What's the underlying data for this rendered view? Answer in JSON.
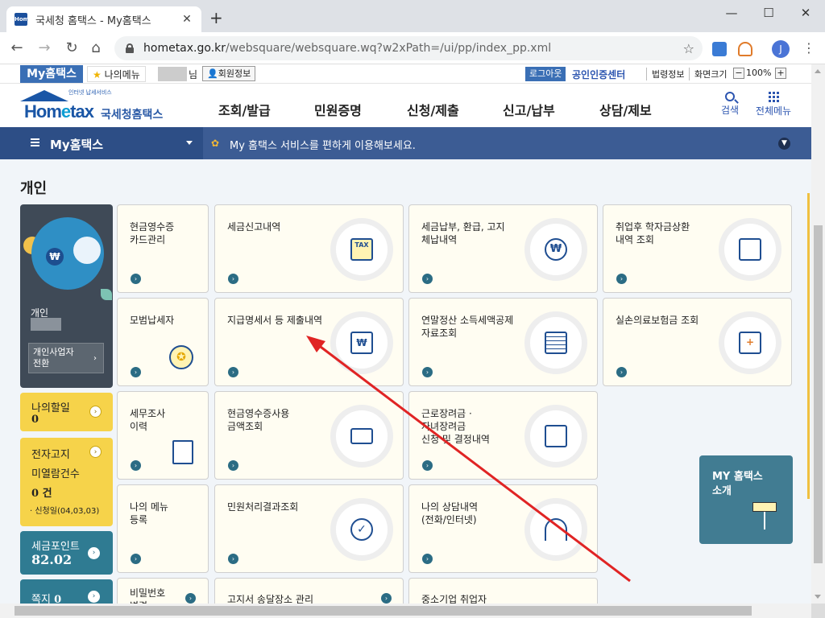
{
  "browser": {
    "tab_title": "국세청 홈택스 - My홈택스",
    "favicon_text": "Home",
    "url_domain": "hometax.go.kr",
    "url_path": "/websquare/websquare.wq?w2xPath=/ui/pp/index_pp.xml",
    "profile_initial": "J"
  },
  "util": {
    "my_hometax": "My홈택스",
    "my_menu": "나의메뉴",
    "name_suffix": "님",
    "member_info": "회원정보",
    "logout": "로그아웃",
    "cert_center": "공인인증센터",
    "law_info": "법령정보",
    "screen_size": "화면크기",
    "zoom_minus": "−",
    "zoom_value": "100%",
    "zoom_plus": "+"
  },
  "logo": {
    "tagline": "인터넷 납세서비스",
    "brand_pre": "Hom",
    "brand_e": "e",
    "brand_post": "tax",
    "brand_kor": "국세청홈택스"
  },
  "gnb": {
    "items": [
      "조회/발급",
      "민원증명",
      "신청/제출",
      "신고/납부",
      "상담/제보"
    ],
    "search": "검색",
    "all_menu": "전체메뉴"
  },
  "subbar": {
    "title": "My홈택스",
    "message": "My 홈택스 서비스를 편하게 이용해보세요."
  },
  "section_title": "개인",
  "profile": {
    "kind": "개인",
    "switch_label": "개인사업자\n전환",
    "won": "₩"
  },
  "side": {
    "todo_label": "나의할일",
    "todo_count": "0",
    "ebill_label1": "전자고지",
    "ebill_label2": "미열람건수",
    "ebill_count": "0 건",
    "ebill_note": "· 신청일(04,03,03)",
    "points_label": "세금포인트",
    "points_value": "82.02",
    "note_label": "쪽지",
    "note_count": "0"
  },
  "tiles": [
    {
      "label": "현금영수증\n카드관리"
    },
    {
      "label": "세금신고내역",
      "icon": "TAX"
    },
    {
      "label": "세금납부, 환급, 고지\n체납내역",
      "icon": "₩"
    },
    {
      "label": "취업후 학자금상환\n내역 조회"
    },
    {
      "label": "모범납세자"
    },
    {
      "label": "지급명세서 등 제출내역",
      "icon": "₩"
    },
    {
      "label": "연말정산 소득세액공제\n자료조회"
    },
    {
      "label": "실손의료보험금 조회"
    },
    {
      "label": "세무조사\n이력"
    },
    {
      "label": "현금영수증사용\n금액조회"
    },
    {
      "label": "근로장려금 ·\n자녀장려금\n신청 및 결정내역"
    },
    {
      "label": "나의 메뉴\n등록"
    },
    {
      "label": "민원처리결과조회"
    },
    {
      "label": "나의 상담내역\n(전화/인터넷)"
    },
    {
      "label": "비밀번호\n변경"
    },
    {
      "label": "고지서 송달장소 관리"
    },
    {
      "label": "중소기업 취업자"
    }
  ],
  "my_intro": "MY 홈택스\n소개",
  "colors": {
    "accent": "#2c55b0",
    "subbar": "#3c5c94",
    "yellow_card": "#f6d34a",
    "teal_card": "#2f7b92",
    "arrow": "#e02424"
  }
}
